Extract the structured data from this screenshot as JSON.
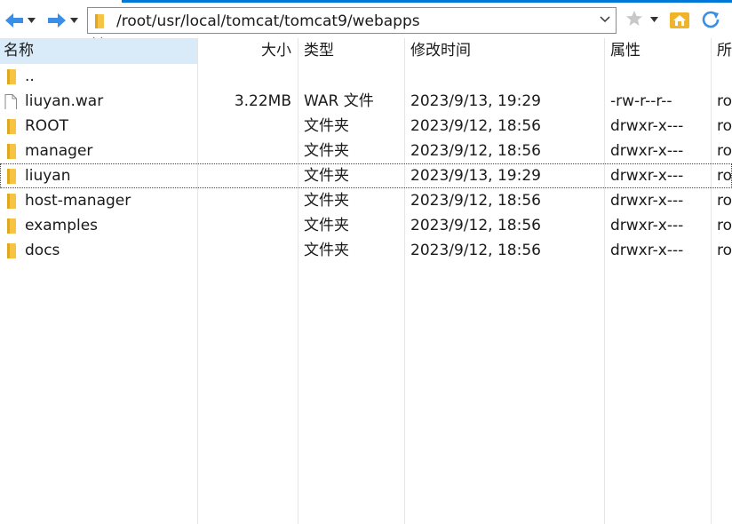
{
  "address": {
    "path": "/root/usr/local/tomcat/tomcat9/webapps"
  },
  "columns": {
    "name": "名称",
    "size": "大小",
    "type": "类型",
    "modified": "修改时间",
    "attributes": "属性",
    "owner": "所"
  },
  "rows": [
    {
      "name": "..",
      "size": "",
      "type": "",
      "modified": "",
      "attributes": "",
      "owner": "",
      "icon": "folder-icon"
    },
    {
      "name": "liuyan.war",
      "size": "3.22MB",
      "type": "WAR 文件",
      "modified": "2023/9/13, 19:29",
      "attributes": "-rw-r--r--",
      "owner": "ro",
      "icon": "file-icon"
    },
    {
      "name": "ROOT",
      "size": "",
      "type": "文件夹",
      "modified": "2023/9/12, 18:56",
      "attributes": "drwxr-x---",
      "owner": "ro",
      "icon": "folder-icon"
    },
    {
      "name": "manager",
      "size": "",
      "type": "文件夹",
      "modified": "2023/9/12, 18:56",
      "attributes": "drwxr-x---",
      "owner": "ro",
      "icon": "folder-icon"
    },
    {
      "name": "liuyan",
      "size": "",
      "type": "文件夹",
      "modified": "2023/9/13, 19:29",
      "attributes": "drwxr-x---",
      "owner": "ro",
      "icon": "folder-icon"
    },
    {
      "name": "host-manager",
      "size": "",
      "type": "文件夹",
      "modified": "2023/9/12, 18:56",
      "attributes": "drwxr-x---",
      "owner": "ro",
      "icon": "folder-icon"
    },
    {
      "name": "examples",
      "size": "",
      "type": "文件夹",
      "modified": "2023/9/12, 18:56",
      "attributes": "drwxr-x---",
      "owner": "ro",
      "icon": "folder-icon"
    },
    {
      "name": "docs",
      "size": "",
      "type": "文件夹",
      "modified": "2023/9/12, 18:56",
      "attributes": "drwxr-x---",
      "owner": "ro",
      "icon": "folder-icon"
    }
  ],
  "colors": {
    "accent": "#0078d7",
    "header_selected": "#d9ebf9",
    "folder": "#f6c342",
    "nav_arrow": "#3a8ee6"
  }
}
